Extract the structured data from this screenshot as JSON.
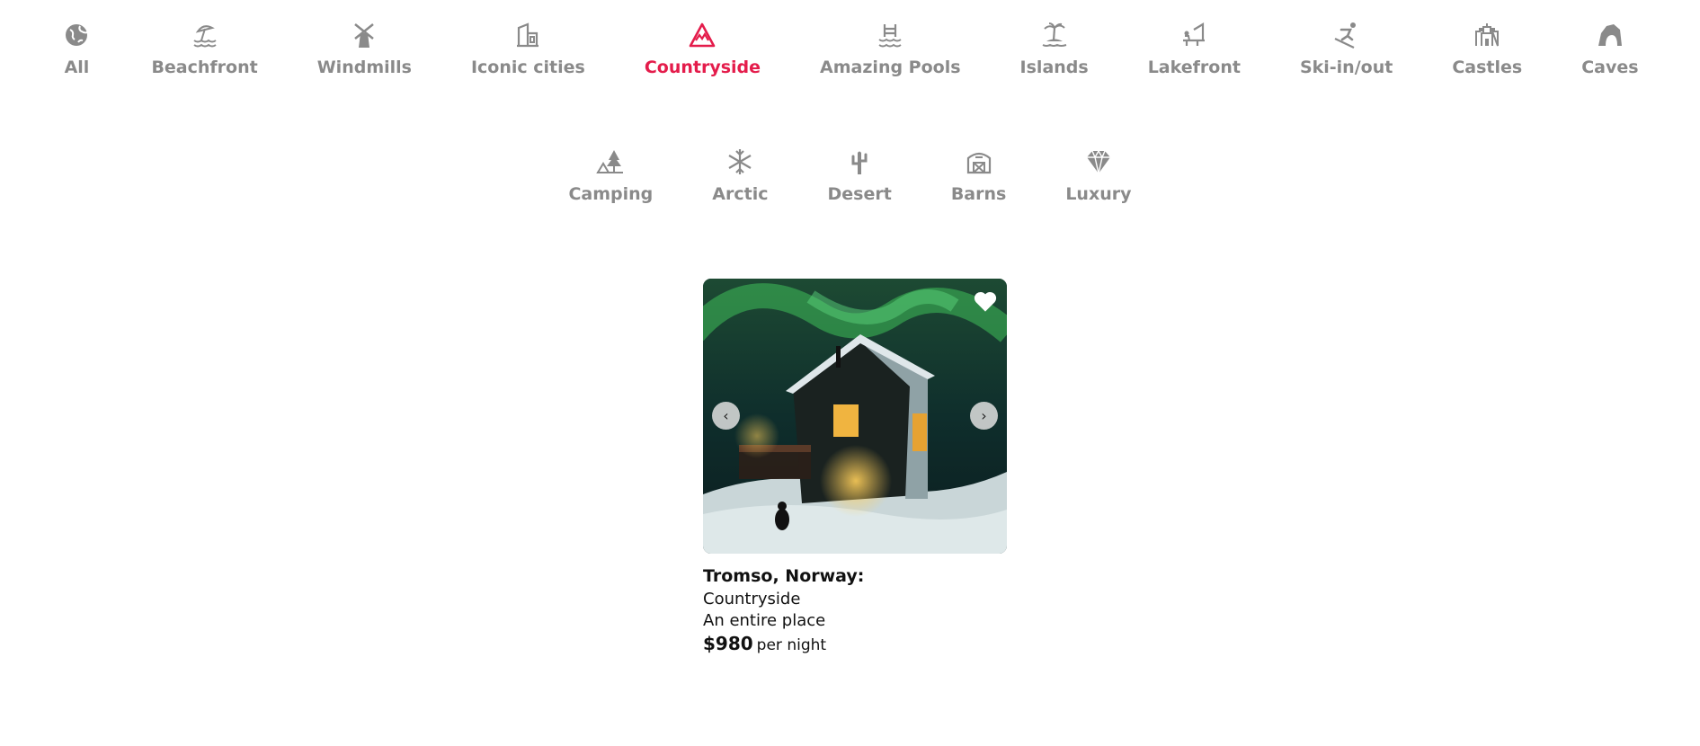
{
  "categories_row1": [
    {
      "label": "All",
      "icon": "globe-icon"
    },
    {
      "label": "Beachfront",
      "icon": "beach-umbrella-icon"
    },
    {
      "label": "Windmills",
      "icon": "windmill-icon"
    },
    {
      "label": "Iconic cities",
      "icon": "city-building-icon"
    },
    {
      "label": "Countryside",
      "icon": "mountain-icon",
      "active": true
    },
    {
      "label": "Amazing Pools",
      "icon": "pool-icon"
    },
    {
      "label": "Islands",
      "icon": "palm-island-icon"
    },
    {
      "label": "Lakefront",
      "icon": "lake-pier-icon"
    },
    {
      "label": "Ski-in/out",
      "icon": "skier-icon"
    },
    {
      "label": "Castles",
      "icon": "castle-icon"
    },
    {
      "label": "Caves",
      "icon": "cave-icon"
    }
  ],
  "categories_row2": [
    {
      "label": "Camping",
      "icon": "tent-tree-icon"
    },
    {
      "label": "Arctic",
      "icon": "snowflake-icon"
    },
    {
      "label": "Desert",
      "icon": "cactus-icon"
    },
    {
      "label": "Barns",
      "icon": "barn-icon"
    },
    {
      "label": "Luxury",
      "icon": "diamond-icon"
    }
  ],
  "colors": {
    "active": "#e41c4b",
    "inactive": "#8a8a8a"
  },
  "listing": {
    "location": "Tromso, Norway:",
    "category": "Countryside",
    "type": "An entire place",
    "price": "$980",
    "price_suffix": "per night",
    "prev_label": "‹",
    "next_label": "›"
  }
}
